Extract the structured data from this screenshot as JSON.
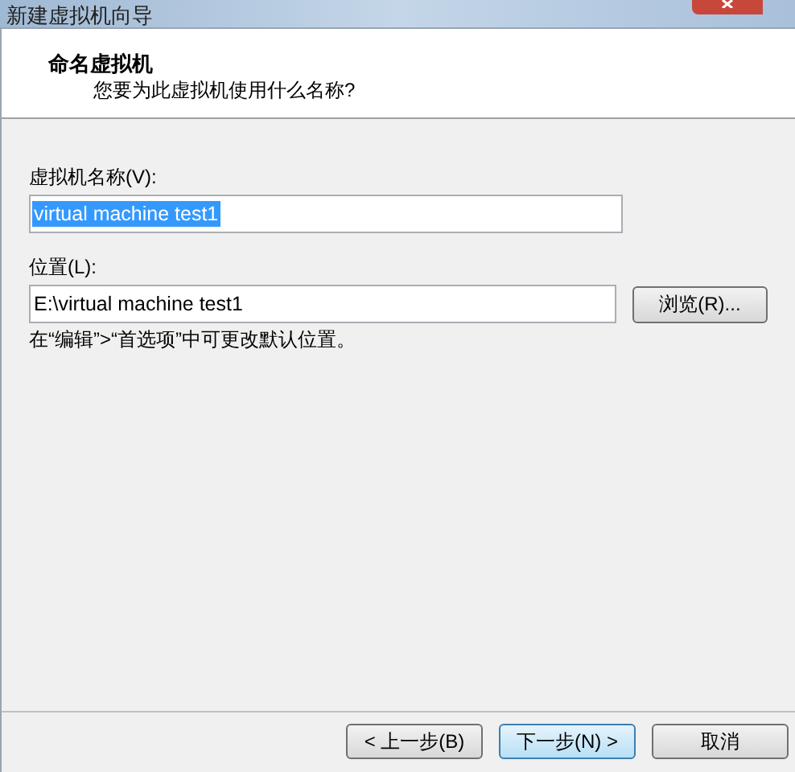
{
  "window": {
    "title": "新建虚拟机向导"
  },
  "header": {
    "title": "命名虚拟机",
    "subtitle": "您要为此虚拟机使用什么名称?"
  },
  "fields": [
    {
      "label": "虚拟机名称(V):",
      "value": "virtual machine test1",
      "selected": true
    },
    {
      "label": "位置(L):",
      "value": "E:\\virtual machine test1",
      "selected": false,
      "button": "浏览(R)..."
    }
  ],
  "hint": "在“编辑”>“首选项”中可更改默认位置。",
  "buttons": [
    {
      "label": "< 上一步(B)",
      "focused": false
    },
    {
      "label": "下一步(N) >",
      "focused": true
    },
    {
      "label": "取消",
      "focused": false
    }
  ]
}
